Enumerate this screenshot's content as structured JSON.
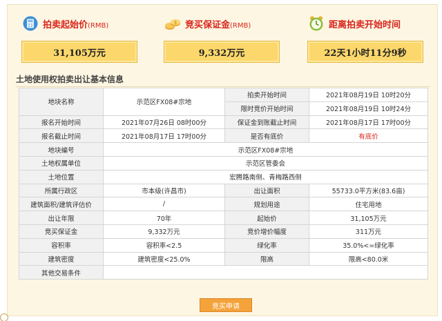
{
  "stats": [
    {
      "title": "拍卖起始价",
      "unit": "(RMB)",
      "value": "31,105万元",
      "icon": "calculator-icon"
    },
    {
      "title": "竞买保证金",
      "unit": "(RMB)",
      "value": "9,332万元",
      "icon": "coins-icon"
    },
    {
      "title": "距离拍卖开始时间",
      "unit": "",
      "value": "22天1小时11分9秒",
      "icon": "alarm-clock-icon"
    }
  ],
  "section_title": "土地使用权拍卖出让基本信息",
  "table": {
    "parcel_name_label": "地块名称",
    "parcel_name_value": "示范区FX08#宗地",
    "auction_start_label": "拍卖开始时间",
    "auction_start_value": "2021年08月19日 10时20分",
    "timed_bid_label": "限时竞价开始时间",
    "timed_bid_value": "2021年08月19日 10时24分",
    "reg_start_label": "报名开始时间",
    "reg_start_value": "2021年07月26日 08时00分",
    "deposit_deadline_label": "保证金到账截止时间",
    "deposit_deadline_value": "2021年08月17日 17时00分",
    "reg_end_label": "报名截止时间",
    "reg_end_value": "2021年08月17日 17时00分",
    "reserve_label": "是否有底价",
    "reserve_value": "有底价",
    "parcel_no_label": "地块编号",
    "parcel_no_value": "示范区FX08#宗地",
    "owner_label": "土地权属单位",
    "owner_value": "示范区管委会",
    "location_label": "土地位置",
    "location_value": "宏腾路南侧、青梅路西侧",
    "district_label": "所属行政区",
    "district_value": "市本级(许昌市)",
    "area_label": "出让面积",
    "area_value": "55733.0平方米(83.6亩)",
    "build_area_label": "建筑面积/建筑评估价",
    "build_area_value": "/",
    "use_label": "规划用途",
    "use_value": "住宅用地",
    "term_label": "出让年限",
    "term_value": "70年",
    "start_price_label": "起始价",
    "start_price_value": "31,105万元",
    "deposit_label": "竞买保证金",
    "deposit_value": "9,332万元",
    "increment_label": "竞价增价幅度",
    "increment_value": "311万元",
    "far_label": "容积率",
    "far_value": "容积率<2.5",
    "green_label": "绿化率",
    "green_value": "35.0%<=绿化率",
    "density_label": "建筑密度",
    "density_value": "建筑密度<25.0%",
    "height_label": "限高",
    "height_value": "限高<80.0米",
    "other_label": "其他交易条件",
    "other_value": ""
  },
  "apply_button": "竞买申请",
  "colors": {
    "accent_red": "#d9261c",
    "box_fill": "#fcd86c",
    "button": "#f4a23a",
    "panel_bg": "#fdf6e3"
  }
}
